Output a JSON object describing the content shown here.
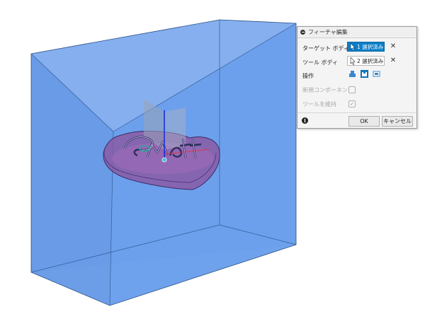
{
  "dialog": {
    "title": "フィーチャ編集",
    "rows": {
      "target_body": {
        "label": "ターゲット ボディ",
        "selection": "1 選択済み"
      },
      "tool_body": {
        "label": "ツール ボディ",
        "selection": "2 選択済み"
      },
      "operation": {
        "label": "操作",
        "options": [
          "join",
          "cut",
          "intersect"
        ],
        "selected": "cut"
      },
      "new_component": {
        "label": "新規コンポーネント",
        "checked": false,
        "enabled": false
      },
      "keep_tools": {
        "label": "ツールを維持",
        "checked": true,
        "enabled": false
      }
    },
    "clear_symbol": "✕",
    "info_symbol": "i",
    "ok_label": "OK",
    "cancel_label": "キャンセル"
  },
  "viewport": {
    "box_color": "#5b95e8",
    "heart_color": "#9b5fa8",
    "text_label": "Matt"
  }
}
